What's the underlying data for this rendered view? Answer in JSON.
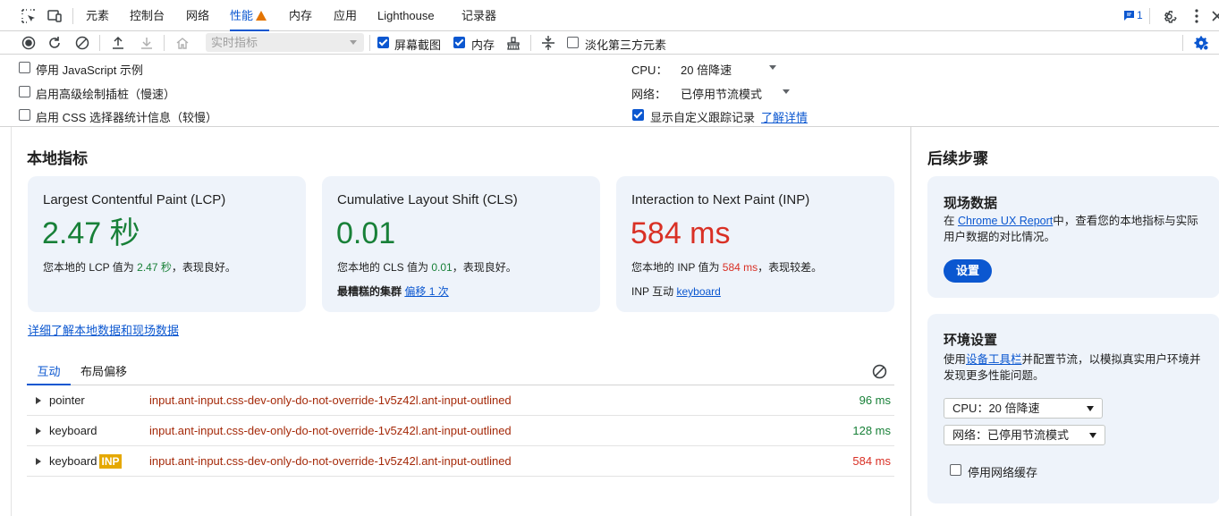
{
  "tabbar": {
    "tabs": [
      "元素",
      "控制台",
      "网络",
      "性能",
      "内存",
      "应用",
      "Lighthouse",
      "记录器"
    ],
    "issues_count": "1"
  },
  "toolbar": {
    "select_placeholder": "实时指标",
    "screenshots_label": "屏幕截图",
    "memory_label": "内存",
    "dim_third_party_label": "淡化第三方元素"
  },
  "settings": {
    "disable_js_samples": "停用 JavaScript 示例",
    "advanced_paint": "启用高级绘制插桩（慢速）",
    "css_selector_stats": "启用 CSS 选择器统计信息（较慢）",
    "cpu_label": "CPU：",
    "cpu_value": "20 倍降速",
    "network_label": "网络：",
    "network_value": "已停用节流模式",
    "custom_tracks": "显示自定义跟踪记录",
    "learn_more": "了解详情"
  },
  "main": {
    "title": "本地指标",
    "cards": [
      {
        "title": "Largest Contentful Paint (LCP)",
        "value": "2.47 秒",
        "desc_pre": "您本地的 LCP 值为 ",
        "desc_val": "2.47 秒",
        "desc_post": "，表现良好。"
      },
      {
        "title": "Cumulative Layout Shift (CLS)",
        "value": "0.01",
        "desc_pre": "您本地的 CLS 值为 ",
        "desc_val": "0.01",
        "desc_post": "，表现良好。",
        "extra_label": "最糟糕的集群",
        "extra_link": "偏移 1 次"
      },
      {
        "title": "Interaction to Next Paint (INP)",
        "value": "584 ms",
        "desc_pre": "您本地的 INP 值为 ",
        "desc_val": "584 ms",
        "desc_post": "，表现较差。",
        "extra_label": "INP 互动",
        "extra_link": "keyboard"
      }
    ],
    "learn_link": "详细了解本地数据和现场数据",
    "subtabs": [
      "互动",
      "布局偏移"
    ],
    "interactions": [
      {
        "name": "pointer",
        "selector": "input.ant-input.css-dev-only-do-not-override-1v5z42l.ant-input-outlined",
        "duration": "96 ms",
        "inp": ""
      },
      {
        "name": "keyboard",
        "selector": "input.ant-input.css-dev-only-do-not-override-1v5z42l.ant-input-outlined",
        "duration": "128 ms",
        "inp": ""
      },
      {
        "name": "keyboard",
        "selector": "input.ant-input.css-dev-only-do-not-override-1v5z42l.ant-input-outlined",
        "duration": "584 ms",
        "inp": "INP"
      }
    ]
  },
  "sidebar": {
    "title": "后续步骤",
    "field_card": {
      "title": "现场数据",
      "text_pre": "在 ",
      "link": "Chrome UX Report",
      "text_post": "中，查看您的本地指标与实际用户数据的对比情况。",
      "button": "设置"
    },
    "env_card": {
      "title": "环境设置",
      "text_pre": "使用",
      "link": "设备工具栏",
      "text_post": "并配置节流，以模拟真实用户环境并发现更多性能问题。",
      "cpu_select": "CPU：20 倍降速",
      "network_select": "网络：已停用节流模式",
      "disable_cache": "停用网络缓存"
    }
  },
  "colors": {
    "accent": "#0b57d0",
    "good": "#188038",
    "bad": "#d93025",
    "warning": "#e37400",
    "card_bg": "#eef3fa"
  }
}
